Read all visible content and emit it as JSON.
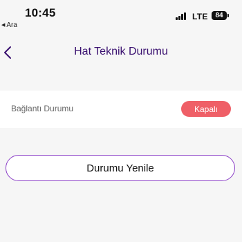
{
  "status_bar": {
    "time": "10:45",
    "back_app": "Ara",
    "network": "LTE",
    "battery": "84"
  },
  "nav": {
    "title": "Hat Teknik Durumu"
  },
  "connection": {
    "label": "Bağlantı Durumu",
    "status": "Kapalı",
    "status_color": "#ef5f67"
  },
  "actions": {
    "refresh_label": "Durumu Yenile"
  },
  "colors": {
    "accent": "#8b3fc7",
    "title": "#3a1170"
  }
}
